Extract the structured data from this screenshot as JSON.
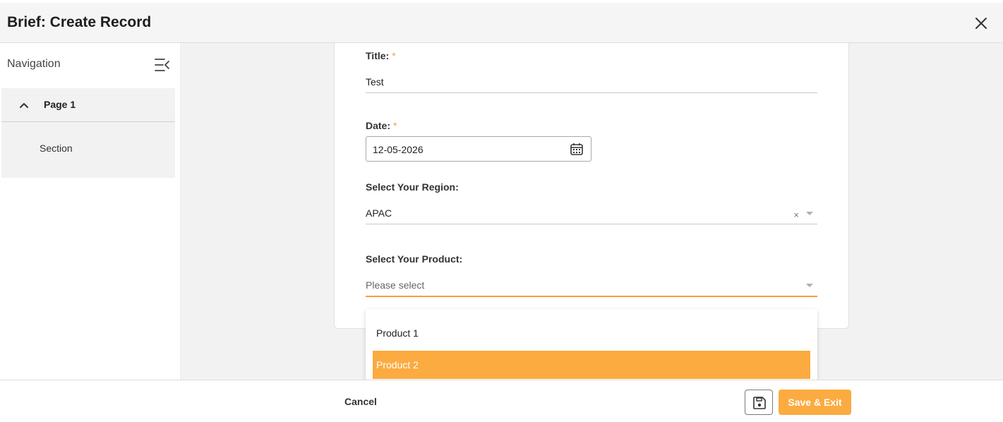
{
  "header": {
    "title": "Brief: Create Record"
  },
  "sidebar": {
    "title": "Navigation",
    "pages": [
      {
        "label": "Page 1",
        "sections": [
          {
            "label": "Section"
          }
        ]
      }
    ]
  },
  "form": {
    "title_field": {
      "label": "Title:",
      "required_mark": "*",
      "value": "Test"
    },
    "date_field": {
      "label": "Date:",
      "required_mark": "*",
      "value": "12-05-2026"
    },
    "region_field": {
      "label": "Select Your Region:",
      "value": "APAC",
      "clear_glyph": "×"
    },
    "product_field": {
      "label": "Select Your Product:",
      "placeholder": "Please select"
    }
  },
  "dropdown": {
    "options": [
      {
        "label": "Product 1",
        "selected": false
      },
      {
        "label": "Product 2",
        "selected": true
      }
    ]
  },
  "footer": {
    "cancel_label": "Cancel",
    "save_exit_label": "Save & Exit"
  },
  "colors": {
    "accent": "#fbab40",
    "required": "#f5a03c",
    "panel_bg": "#f2f2f2"
  },
  "icons": {
    "close": "close-icon",
    "collapse": "menu-collapse-icon",
    "chevron": "chevron-up-icon",
    "calendar": "calendar-icon",
    "save": "floppy-disk-icon"
  }
}
